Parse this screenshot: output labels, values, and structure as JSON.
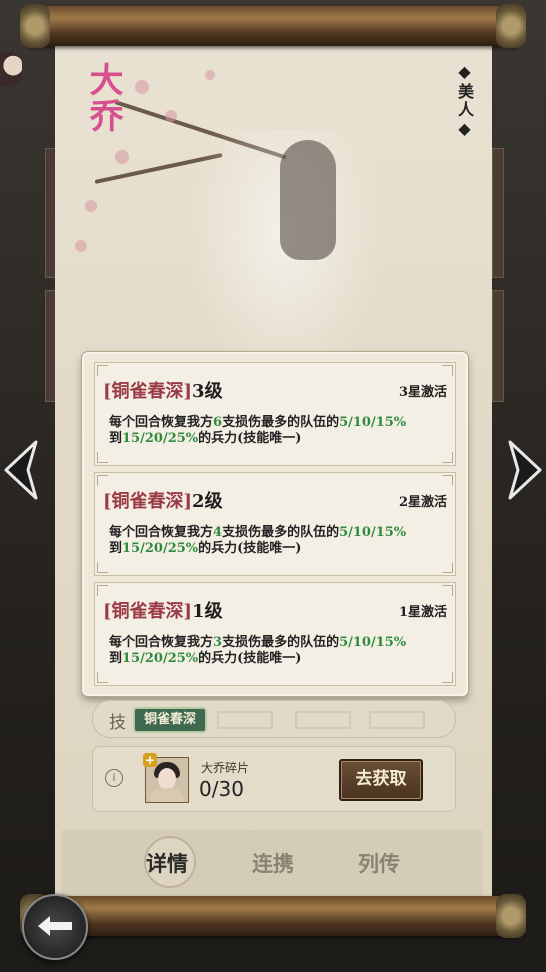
{
  "hero": {
    "name": "大乔",
    "tag": "美人"
  },
  "skills": [
    {
      "name": "[铜雀春深]",
      "level": "3级",
      "star": "3星激活",
      "desc_pre": "每个回合恢复我方",
      "desc_count": "6",
      "desc_mid": "支损伤最多的队伍的",
      "desc_pct1": "5/10/15%",
      "desc_to": "到",
      "desc_pct2": "15/20/25%",
      "desc_post": "的兵力(技能唯一)"
    },
    {
      "name": "[铜雀春深]",
      "level": "2级",
      "star": "2星激活",
      "desc_pre": "每个回合恢复我方",
      "desc_count": "4",
      "desc_mid": "支损伤最多的队伍的",
      "desc_pct1": "5/10/15%",
      "desc_to": "到",
      "desc_pct2": "15/20/25%",
      "desc_post": "的兵力(技能唯一)"
    },
    {
      "name": "[铜雀春深]",
      "level": "1级",
      "star": "1星激活",
      "desc_pre": "每个回合恢复我方",
      "desc_count": "3",
      "desc_mid": "支损伤最多的队伍的",
      "desc_pct1": "5/10/15%",
      "desc_to": "到",
      "desc_pct2": "15/20/25%",
      "desc_post": "的兵力(技能唯一)"
    }
  ],
  "skill_bar": {
    "label": "技",
    "chip": "铜雀春深"
  },
  "fragment": {
    "name": "大乔碎片",
    "count": "0/30",
    "button": "去获取"
  },
  "tabs": [
    {
      "label": "详情"
    },
    {
      "label": "连携"
    },
    {
      "label": "列传"
    }
  ],
  "colors": {
    "name_pink": "#d64f8f",
    "skill_red": "#9a3b45",
    "value_green": "#2e8b3c",
    "chip_green": "#3f6a50"
  }
}
